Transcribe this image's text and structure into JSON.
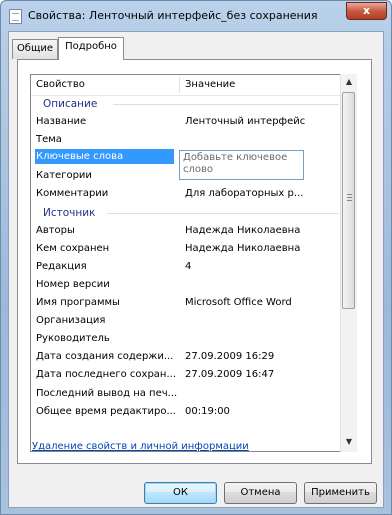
{
  "window": {
    "title": "Свойства: Ленточный интерфейс_без сохранения",
    "close_glyph": "x"
  },
  "tabs": [
    {
      "label": "Общие",
      "active": false
    },
    {
      "label": "Подробно",
      "active": true
    }
  ],
  "list": {
    "columns": {
      "property": "Свойство",
      "value": "Значение"
    },
    "groups": [
      {
        "label": "Описание",
        "rows": [
          {
            "property": "Название",
            "value": "Ленточный интерфейс"
          },
          {
            "property": "Тема",
            "value": ""
          },
          {
            "property": "Ключевые слова",
            "value": "",
            "selected": true,
            "edit_placeholder": "Добавьте ключевое слово"
          },
          {
            "property": "Категории",
            "value": ""
          },
          {
            "property": "Комментарии",
            "value": "Для лабораторных р..."
          }
        ]
      },
      {
        "label": "Источник",
        "rows": [
          {
            "property": "Авторы",
            "value": "Надежда Николаевна"
          },
          {
            "property": "Кем сохранен",
            "value": "Надежда Николаевна"
          },
          {
            "property": "Редакция",
            "value": "4"
          },
          {
            "property": "Номер версии",
            "value": ""
          },
          {
            "property": "Имя программы",
            "value": "Microsoft Office Word"
          },
          {
            "property": "Организация",
            "value": ""
          },
          {
            "property": "Руководитель",
            "value": ""
          },
          {
            "property": "Дата создания содержи...",
            "value": "27.09.2009 16:29"
          },
          {
            "property": "Дата последнего сохран...",
            "value": "27.09.2009 16:47"
          },
          {
            "property": "Последний вывод на печ...",
            "value": ""
          },
          {
            "property": "Общее время редактиро...",
            "value": "00:19:00"
          }
        ]
      }
    ],
    "scrollbar": {
      "up_glyph": "▲",
      "down_glyph": "▼"
    }
  },
  "remove_link": "Удаление свойств и личной информации",
  "buttons": {
    "ok": "ОК",
    "cancel": "Отмена",
    "apply": "Применить"
  }
}
